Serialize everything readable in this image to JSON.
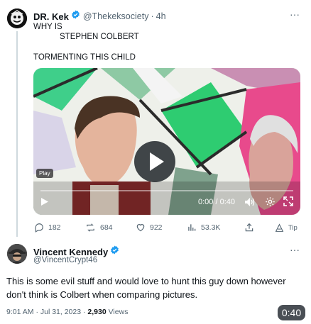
{
  "tweet1": {
    "author_name": "DR. Kek",
    "handle": "@Thekeksociety",
    "time": "4h",
    "more": "···",
    "lines": [
      "WHY IS",
      "STEPHEN COLBERT",
      "TORMENTING THIS CHILD"
    ]
  },
  "video": {
    "badge": "Play",
    "time": "0:00 / 0:40",
    "progress_fraction": 0
  },
  "actions": {
    "replies": "182",
    "reposts": "684",
    "likes": "922",
    "views": "53.3K",
    "tip": "Tip"
  },
  "tweet2": {
    "author_name": "Vincent Kennedy",
    "handle": "@VincentCrypt46",
    "more": "···",
    "body": "This is some evil stuff and would love to hunt this guy down however don't think is Colbert when comparing pictures.",
    "time": "9:01 AM · Jul 31, 2023",
    "dot": " · ",
    "views_count": "2,930",
    "views_label": " Views"
  },
  "overlay": {
    "duration": "0:40"
  },
  "colors": {
    "accent": "#1d9bf0",
    "muted": "#536471",
    "line": "#cfd9de"
  },
  "icons": [
    "verified-badge-icon",
    "more-icon",
    "play-icon",
    "volume-icon",
    "settings-icon",
    "fullscreen-icon",
    "reply-icon",
    "repost-icon",
    "like-icon",
    "views-icon",
    "share-icon",
    "tip-icon"
  ]
}
